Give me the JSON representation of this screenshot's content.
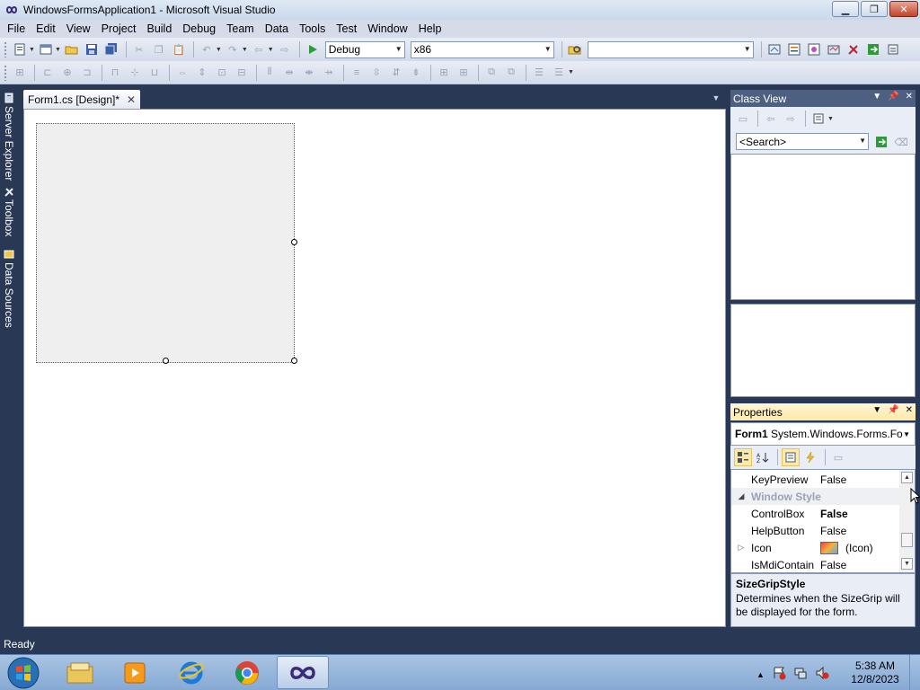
{
  "window": {
    "title": "WindowsFormsApplication1 - Microsoft Visual Studio",
    "minimize_icon": "minimize-icon",
    "maximize_icon": "restore-icon",
    "close_icon": "close-icon"
  },
  "menu": [
    "File",
    "Edit",
    "View",
    "Project",
    "Build",
    "Debug",
    "Team",
    "Data",
    "Tools",
    "Test",
    "Window",
    "Help"
  ],
  "toolbar": {
    "config_combo": "Debug",
    "platform_combo": "x86",
    "find_combo": ""
  },
  "left_tabs": [
    "Server Explorer",
    "Toolbox",
    "Data Sources"
  ],
  "document": {
    "tab_label": "Form1.cs [Design]*",
    "tab_close": "✕"
  },
  "class_view": {
    "title": "Class View",
    "search_placeholder": "<Search>"
  },
  "properties": {
    "title": "Properties",
    "object_name": "Form1",
    "object_type": "System.Windows.Forms.Fo",
    "rows": [
      {
        "name": "KeyPreview",
        "value": "False",
        "bold": false
      },
      {
        "name": "Window Style",
        "category": true
      },
      {
        "name": "ControlBox",
        "value": "False",
        "bold": true
      },
      {
        "name": "HelpButton",
        "value": "False",
        "bold": false
      },
      {
        "name": "Icon",
        "value": "(Icon)",
        "expandable": true
      },
      {
        "name": "IsMdiContain",
        "value": "False",
        "bold": false
      }
    ],
    "description_title": "SizeGripStyle",
    "description_text": "Determines when the SizeGrip will be displayed for the form."
  },
  "status": {
    "text": "Ready"
  },
  "taskbar": {
    "apps": [
      "file-explorer-icon",
      "media-player-icon",
      "internet-explorer-icon",
      "chrome-icon",
      "visual-studio-icon"
    ],
    "active_app": "visual-studio-icon",
    "time": "5:38 AM",
    "date": "12/8/2023"
  },
  "colors": {
    "vs_background": "#293955",
    "panel_header": "#4d6082",
    "active_header": "#ffe9a8"
  }
}
